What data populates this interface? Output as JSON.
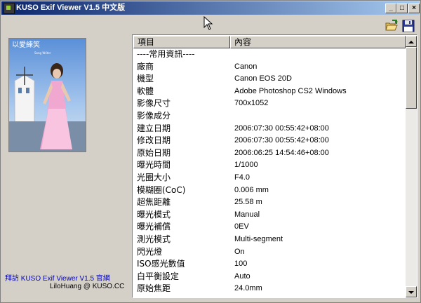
{
  "window": {
    "title": "KUSO Exif Viewer V1.5 中文版",
    "minimize_label": "_",
    "maximize_label": "□",
    "close_label": "×"
  },
  "toolbar": {
    "open_icon": "open-folder-icon",
    "save_icon": "floppy-disk-icon"
  },
  "photo": {
    "caption": "以愛練笑",
    "subcaption": "Song Writer"
  },
  "list": {
    "columns": [
      "項目",
      "內容"
    ],
    "rows": [
      {
        "key": "----常用資訊----",
        "value": ""
      },
      {
        "key": "廠商",
        "value": "Canon"
      },
      {
        "key": "機型",
        "value": "Canon EOS 20D"
      },
      {
        "key": "軟體",
        "value": "Adobe Photoshop CS2 Windows"
      },
      {
        "key": "影像尺寸",
        "value": "700x1052"
      },
      {
        "key": "影像成分",
        "value": ""
      },
      {
        "key": "建立日期",
        "value": "2006:07:30 00:55:42+08:00"
      },
      {
        "key": "修改日期",
        "value": "2006:07:30 00:55:42+08:00"
      },
      {
        "key": "原始日期",
        "value": "2006:06:25 14:54:46+08:00"
      },
      {
        "key": "曝光時間",
        "value": "1/1000"
      },
      {
        "key": "光圈大小",
        "value": "F4.0"
      },
      {
        "key": "模糊圈(CoC)",
        "value": "0.006 mm"
      },
      {
        "key": "超焦距離",
        "value": "25.58 m"
      },
      {
        "key": "曝光模式",
        "value": "Manual"
      },
      {
        "key": "曝光補償",
        "value": "0EV"
      },
      {
        "key": "測光模式",
        "value": "Multi-segment"
      },
      {
        "key": "閃光燈",
        "value": "On"
      },
      {
        "key": "ISO感光數值",
        "value": "100"
      },
      {
        "key": "白平衡設定",
        "value": "Auto"
      },
      {
        "key": "原始焦距",
        "value": "24.0mm"
      }
    ]
  },
  "footer": {
    "link": "拜訪 KUSO Exif Viewer V1.5 官網",
    "author": "LiloHuang @ KUSO.CC"
  },
  "colors": {
    "titlebar_start": "#0a246a",
    "titlebar_end": "#a6caf0",
    "link": "#0000c0"
  }
}
